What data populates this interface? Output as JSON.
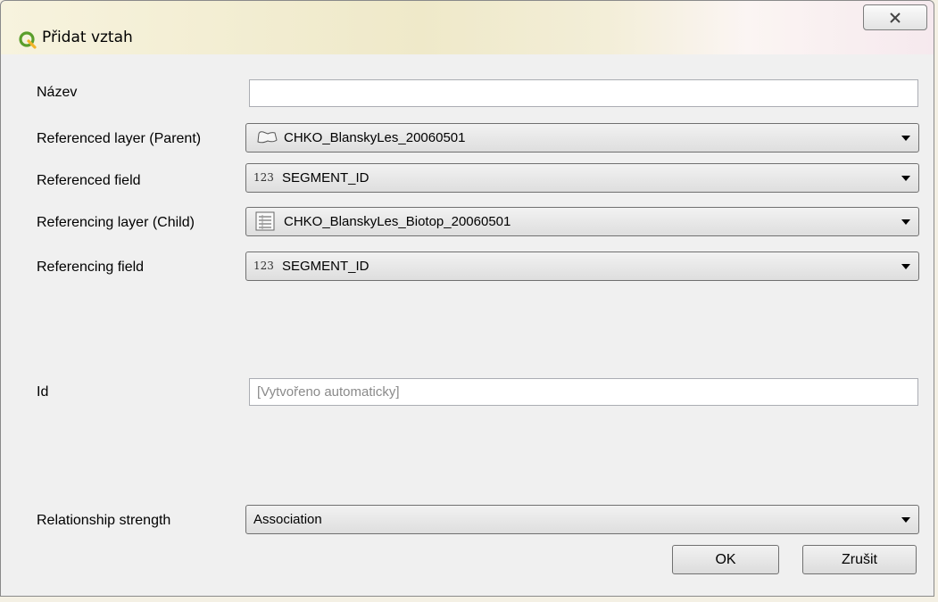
{
  "dialog": {
    "title": "Přidat vztah",
    "close_icon": "close-icon",
    "name": {
      "label": "Název",
      "value": ""
    },
    "referenced_layer": {
      "label": "Referenced layer (Parent)",
      "value": "CHKO_BlanskyLes_20060501",
      "icon": "polygon-layer-icon"
    },
    "referenced_field": {
      "label": "Referenced field",
      "value": "SEGMENT_ID",
      "type_badge": "123"
    },
    "referencing_layer": {
      "label": "Referencing layer (Child)",
      "value": "CHKO_BlanskyLes_Biotop_20060501",
      "icon": "table-layer-icon"
    },
    "referencing_field": {
      "label": "Referencing field",
      "value": "SEGMENT_ID",
      "type_badge": "123"
    },
    "id": {
      "label": "Id",
      "placeholder": "[Vytvořeno automaticky]"
    },
    "strength": {
      "label": "Relationship strength",
      "value": "Association"
    },
    "buttons": {
      "ok": "OK",
      "cancel": "Zrušit"
    }
  }
}
